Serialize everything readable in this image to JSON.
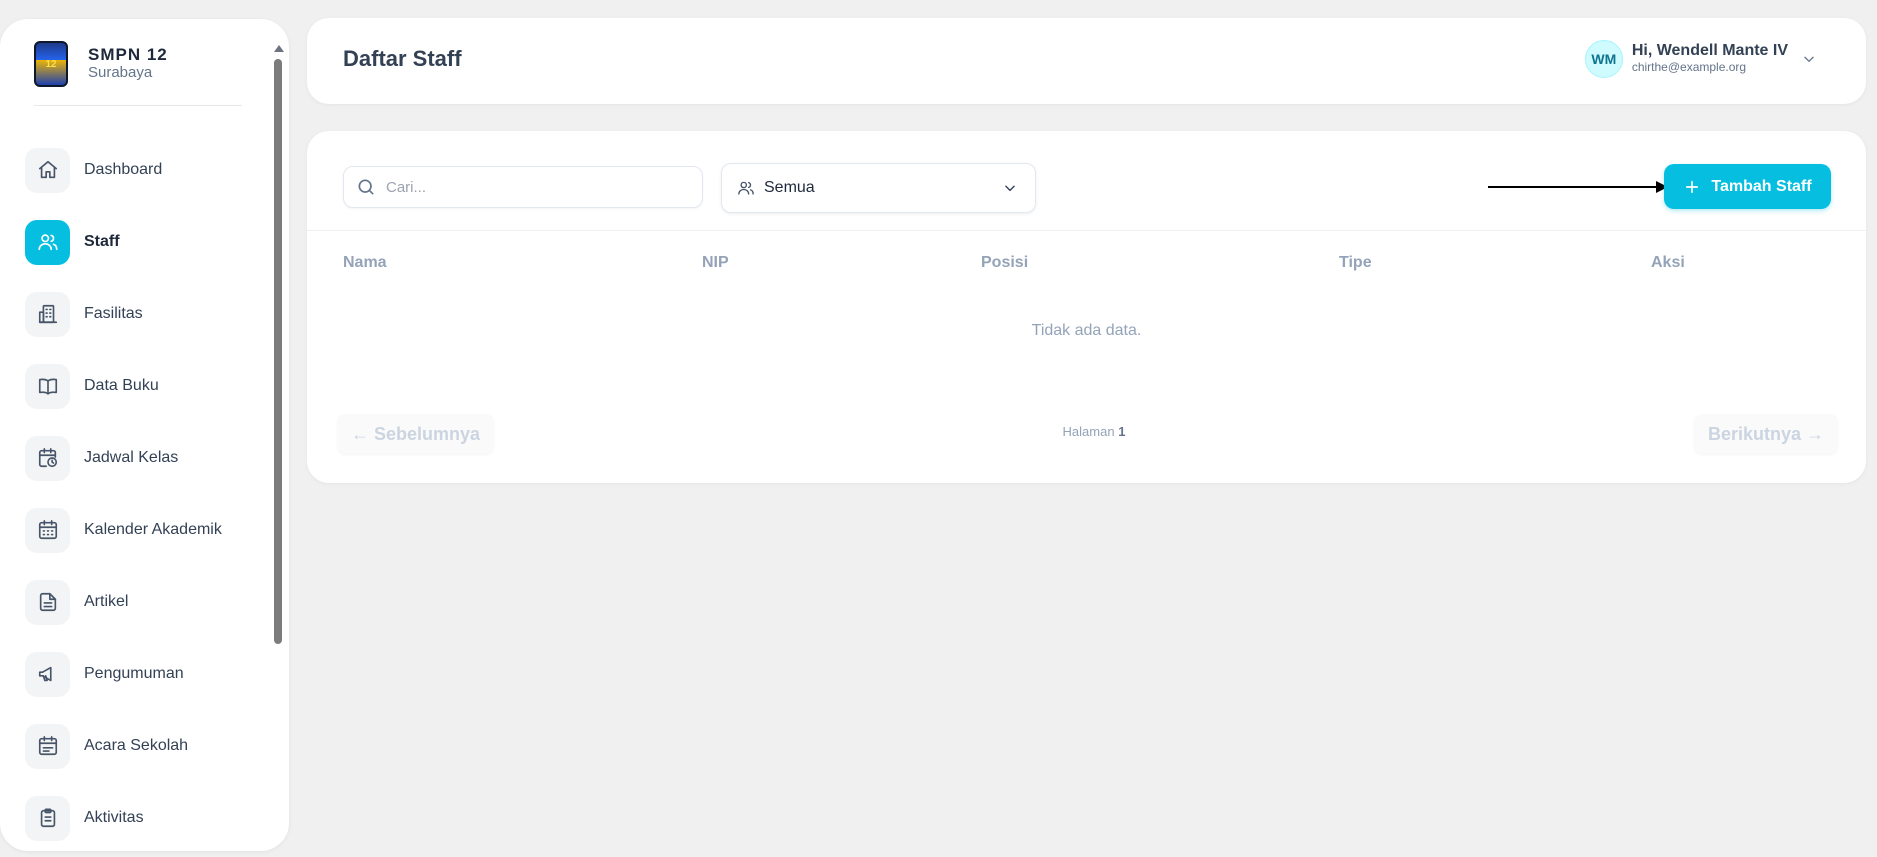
{
  "brand": {
    "title": "SMPN 12",
    "subtitle": "Surabaya"
  },
  "sidebar": {
    "items": [
      {
        "label": "Dashboard",
        "icon": "home-icon"
      },
      {
        "label": "Staff",
        "icon": "users-icon",
        "active": true
      },
      {
        "label": "Fasilitas",
        "icon": "building-icon"
      },
      {
        "label": "Data Buku",
        "icon": "book-icon"
      },
      {
        "label": "Jadwal Kelas",
        "icon": "calendar-clock-icon"
      },
      {
        "label": "Kalender Akademik",
        "icon": "calendar-icon"
      },
      {
        "label": "Artikel",
        "icon": "document-icon"
      },
      {
        "label": "Pengumuman",
        "icon": "megaphone-icon"
      },
      {
        "label": "Acara Sekolah",
        "icon": "calendar-event-icon"
      },
      {
        "label": "Aktivitas",
        "icon": "clipboard-icon"
      }
    ]
  },
  "header": {
    "title": "Daftar Staff",
    "user": {
      "initials": "WM",
      "greeting": "Hi, Wendell Mante IV",
      "email": "chirthe@example.org"
    }
  },
  "toolbar": {
    "search_placeholder": "Cari...",
    "filter_value": "Semua",
    "add_label": "Tambah Staff"
  },
  "table": {
    "columns": [
      "Nama",
      "NIP",
      "Posisi",
      "Tipe",
      "Aksi"
    ],
    "empty_text": "Tidak ada data."
  },
  "pagination": {
    "prev_label": "← Sebelumnya",
    "next_label": "Berikutnya →",
    "page_prefix": "Halaman",
    "page_number": "1"
  },
  "colors": {
    "accent": "#06bfe0",
    "background": "#f0f0f0"
  }
}
